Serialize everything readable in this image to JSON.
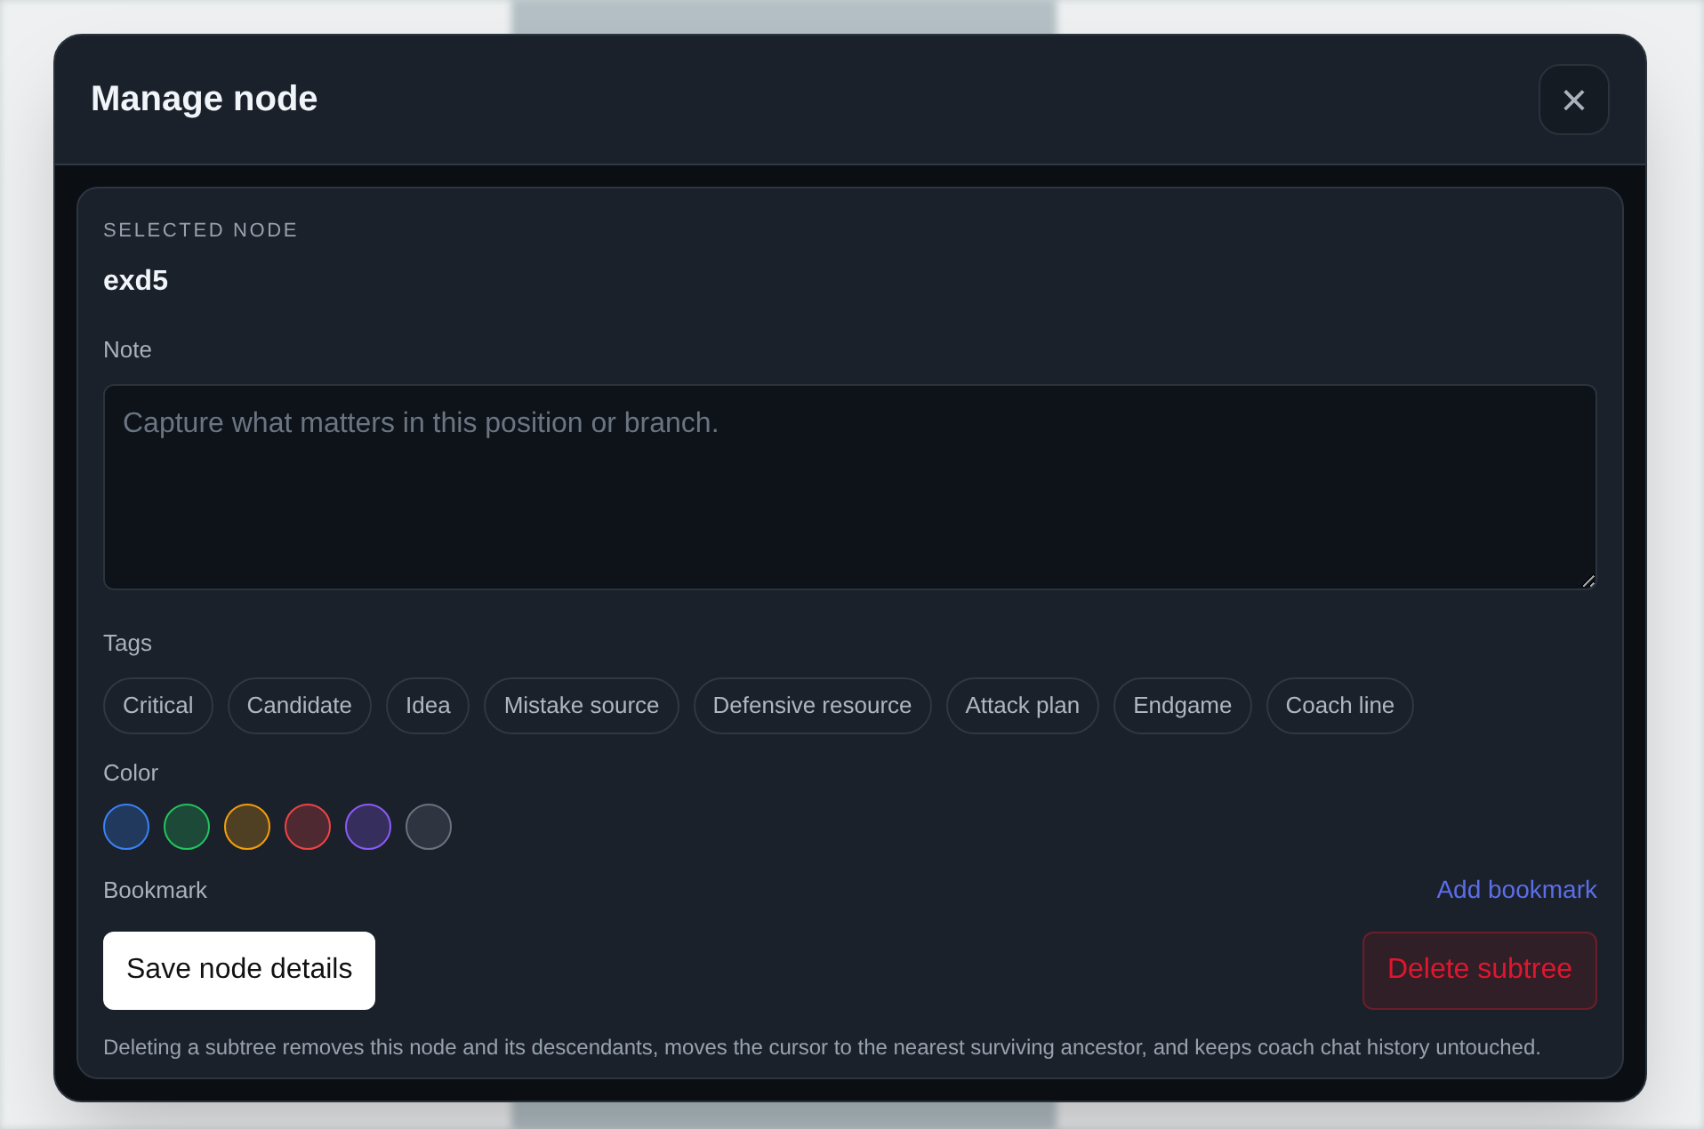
{
  "dialog": {
    "title": "Manage node",
    "close": "×"
  },
  "selected_node": {
    "label": "SELECTED NODE",
    "value": "exd5"
  },
  "note": {
    "label": "Note",
    "placeholder": "Capture what matters in this position or branch."
  },
  "tags": {
    "label": "Tags",
    "items": [
      {
        "label": "Critical"
      },
      {
        "label": "Candidate"
      },
      {
        "label": "Idea"
      },
      {
        "label": "Mistake source"
      },
      {
        "label": "Defensive resource"
      },
      {
        "label": "Attack plan"
      },
      {
        "label": "Endgame"
      },
      {
        "label": "Coach line"
      }
    ]
  },
  "color": {
    "label": "Color",
    "swatches": [
      {
        "color": "#3b82f6"
      },
      {
        "color": "#22c55e"
      },
      {
        "color": "#f59e0b"
      },
      {
        "color": "#ef4444"
      },
      {
        "color": "#8b5cf6"
      },
      {
        "color": "#6b7280"
      }
    ]
  },
  "bookmark": {
    "label": "Bookmark",
    "action": "Add bookmark"
  },
  "buttons": [
    {
      "kind": "primary",
      "label": "Save node details"
    },
    {
      "kind": "danger",
      "label": "Delete subtree"
    }
  ],
  "footnote": "Deleting a subtree removes this node and its descendants, moves the cursor to the nearest surviving ancestor, and keeps coach chat history untouched."
}
